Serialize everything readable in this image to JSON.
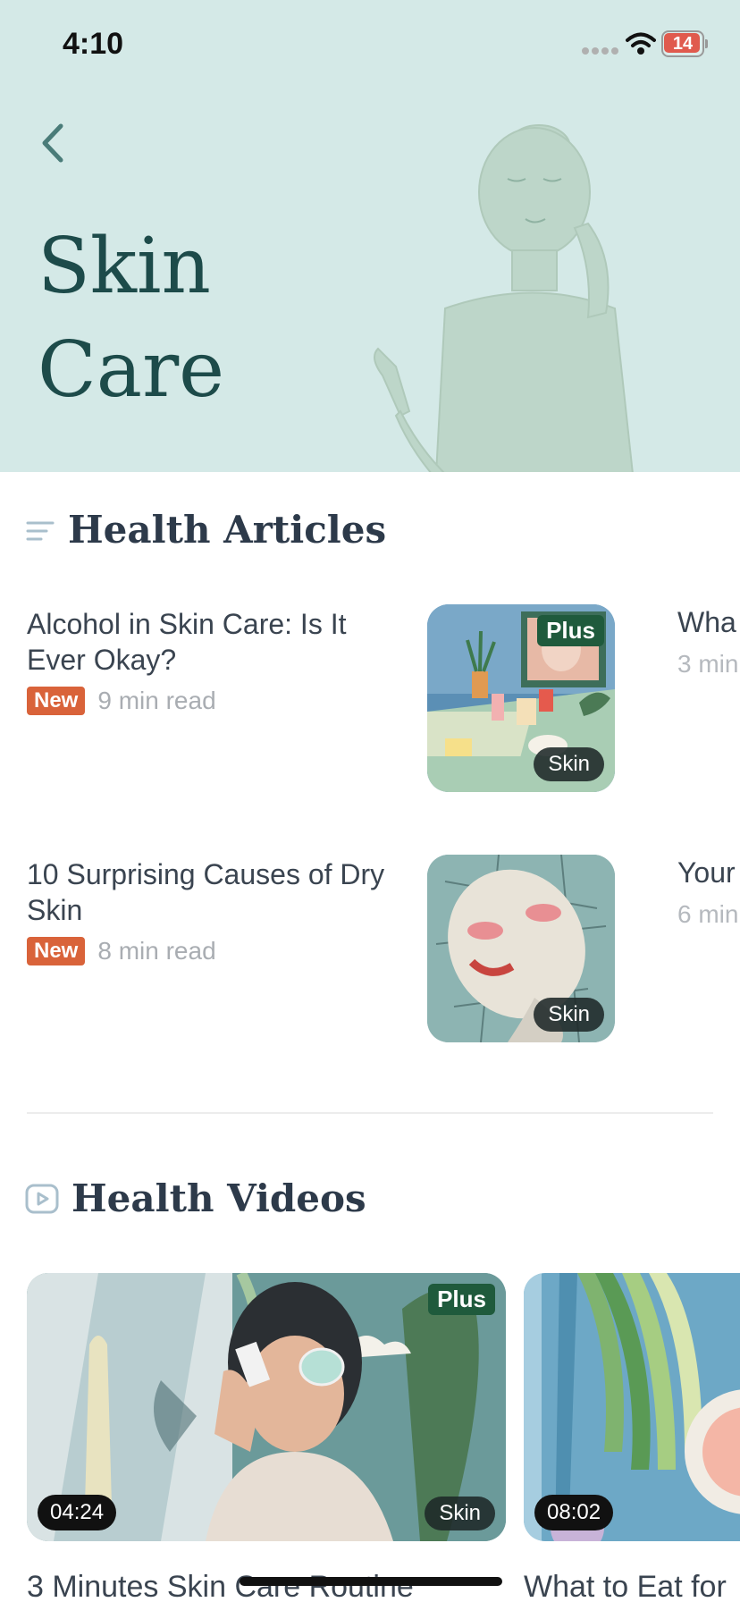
{
  "status_bar": {
    "time": "4:10",
    "battery": "14"
  },
  "header": {
    "title": "Skin\nCare"
  },
  "articles_section": {
    "title": "Health Articles",
    "items": [
      {
        "title": "Alcohol in Skin Care: Is It Ever Okay?",
        "badge": "New",
        "read_time": "9 min read",
        "tag": "Skin",
        "plus": "Plus"
      },
      {
        "title": "10 Surprising Causes of Dry Skin",
        "badge": "New",
        "read_time": "8 min read",
        "tag": "Skin",
        "plus": ""
      }
    ],
    "peek_items": [
      {
        "title": "Wha",
        "sub": "3 min"
      },
      {
        "title": "Your",
        "sub": "6 min"
      }
    ]
  },
  "videos_section": {
    "title": "Health Videos",
    "items": [
      {
        "title": "3 Minutes Skin Care Routine",
        "duration": "04:24",
        "tag": "Skin",
        "plus": "Plus"
      },
      {
        "title": "What to Eat for",
        "duration": "08:02",
        "tag": "",
        "plus": ""
      }
    ]
  },
  "icons": {
    "back": "chevron-left-icon",
    "articles": "lines-icon",
    "videos": "play-icon",
    "wifi": "wifi-icon",
    "signal": "signal-icon",
    "battery": "battery-icon"
  },
  "colors": {
    "header_bg": "#d4e9e7",
    "title": "#1d4b4a",
    "new_badge": "#d9633a",
    "plus_badge": "#1f5a3c"
  }
}
